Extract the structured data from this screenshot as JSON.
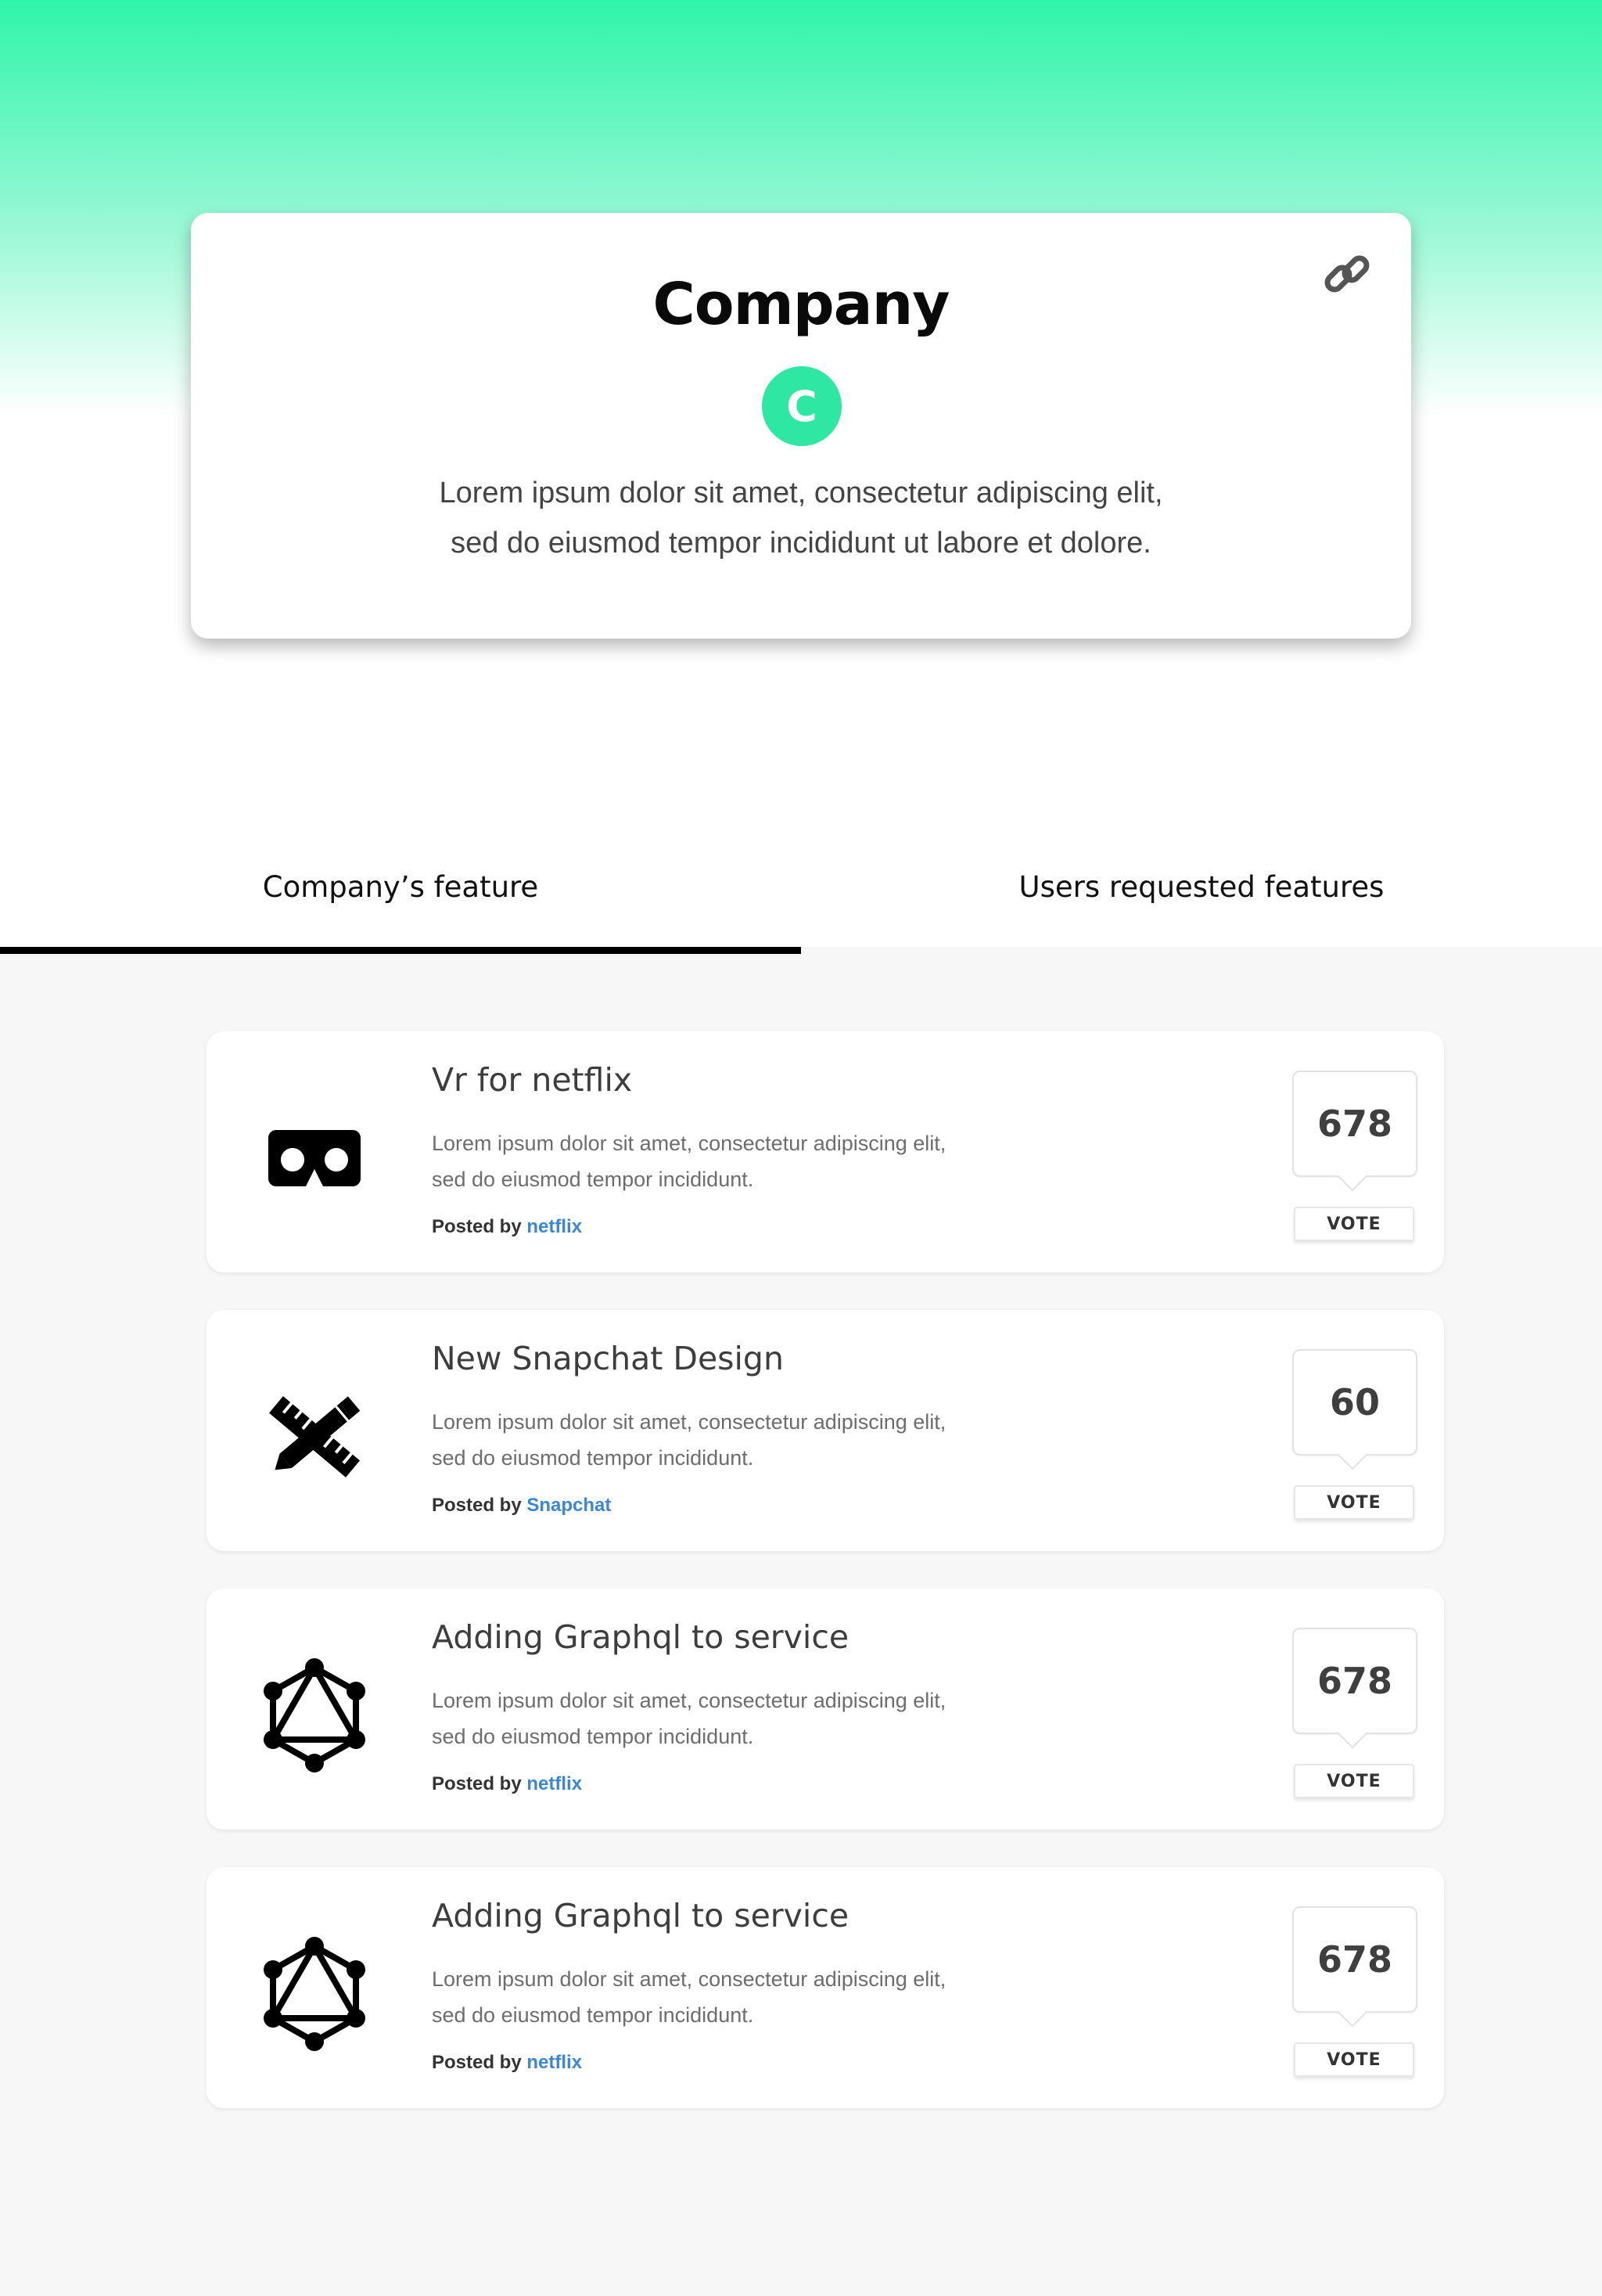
{
  "company": {
    "title": "Company",
    "avatar_letter": "C",
    "description_lines": [
      "Lorem ipsum dolor sit amet, consectetur adipiscing elit,",
      "sed do eiusmod tempor incididunt ut labore et dolore."
    ],
    "link_icon": "link-icon",
    "accent_color": "#2ee7a2"
  },
  "tabs": [
    {
      "label": "Company’s feature",
      "active": true
    },
    {
      "label": "Users requested features",
      "active": false
    }
  ],
  "features": [
    {
      "icon": "vr-goggles-icon",
      "title": "Vr for netflix",
      "description_lines": [
        "Lorem ipsum dolor sit amet, consectetur adipiscing elit,",
        "sed do eiusmod tempor incididunt."
      ],
      "posted_by_label": "Posted by",
      "author": "netflix",
      "votes": "678",
      "vote_label": "VOTE"
    },
    {
      "icon": "pencil-ruler-icon",
      "title": "New Snapchat Design",
      "description_lines": [
        "Lorem ipsum dolor sit amet, consectetur adipiscing elit,",
        "sed do eiusmod tempor incididunt."
      ],
      "posted_by_label": "Posted by",
      "author": "Snapchat",
      "votes": "60",
      "vote_label": "VOTE"
    },
    {
      "icon": "graphql-icon",
      "title": "Adding Graphql to service",
      "description_lines": [
        "Lorem ipsum dolor sit amet, consectetur adipiscing elit,",
        "sed do eiusmod tempor incididunt."
      ],
      "posted_by_label": "Posted by",
      "author": "netflix",
      "votes": "678",
      "vote_label": "VOTE"
    },
    {
      "icon": "graphql-icon",
      "title": "Adding Graphql to service",
      "description_lines": [
        "Lorem ipsum dolor sit amet, consectetur adipiscing elit,",
        "sed do eiusmod tempor incididunt."
      ],
      "posted_by_label": "Posted by",
      "author": "netflix",
      "votes": "678",
      "vote_label": "VOTE"
    }
  ]
}
